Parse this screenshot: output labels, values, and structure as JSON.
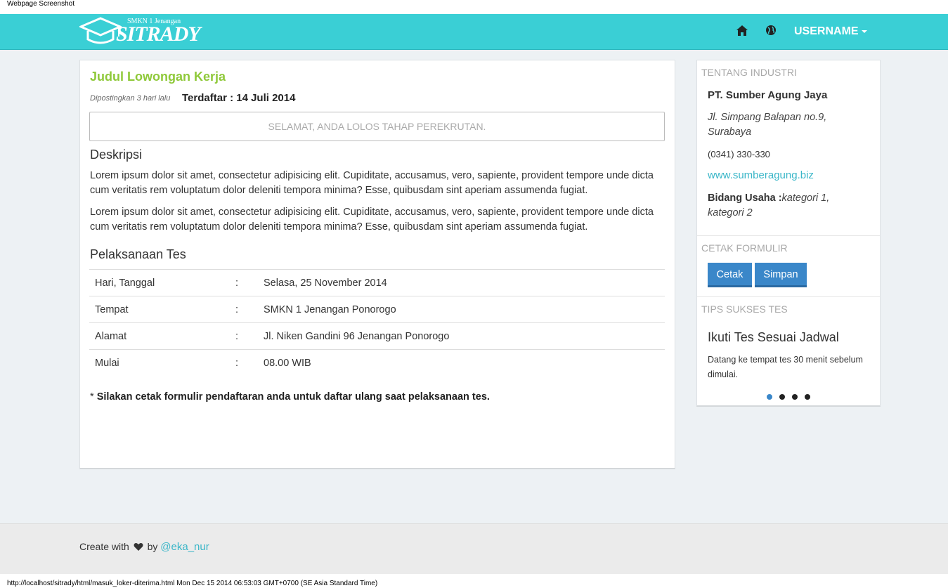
{
  "print_header": "Webpage Screenshot",
  "brand": {
    "sub": "SMKN 1 Jenangan",
    "name": "SITRADY"
  },
  "nav": {
    "user_label": "USERNAME"
  },
  "job": {
    "title": "Judul Lowongan Kerja",
    "posted": "Dipostingkan 3 hari lalu",
    "registered": "Terdaftar : 14 Juli 2014",
    "alert": "SELAMAT, ANDA LOLOS TAHAP PEREKRUTAN.",
    "desc_heading": "Deskripsi",
    "paragraphs": [
      "Lorem ipsum dolor sit amet, consectetur adipisicing elit. Cupiditate, accusamus, vero, sapiente, provident tempore unde dicta cum veritatis rem voluptatum dolor deleniti tempora minima? Esse, quibusdam sint aperiam assumenda fugiat.",
      "Lorem ipsum dolor sit amet, consectetur adipisicing elit. Cupiditate, accusamus, vero, sapiente, provident tempore unde dicta cum veritatis rem voluptatum dolor deleniti tempora minima? Esse, quibusdam sint aperiam assumenda fugiat."
    ],
    "test_heading": "Pelaksanaan Tes",
    "test_rows": [
      {
        "key": "Hari, Tanggal",
        "sep": ":",
        "value": "Selasa, 25 November 2014"
      },
      {
        "key": "Tempat",
        "sep": ":",
        "value": "SMKN 1 Jenangan Ponorogo"
      },
      {
        "key": "Alamat",
        "sep": ":",
        "value": "Jl. Niken Gandini 96 Jenangan Ponorogo"
      },
      {
        "key": "Mulai",
        "sep": ":",
        "value": "08.00 WIB"
      }
    ],
    "note_prefix": "*",
    "note": "Silakan cetak formulir pendaftaran anda untuk daftar ulang saat pelaksanaan tes."
  },
  "sidebar": {
    "industry_heading": "TENTANG INDUSTRI",
    "company": "PT. Sumber Agung Jaya",
    "address": "Jl. Simpang Balapan no.9, Surabaya",
    "phone": "(0341) 330-330",
    "website": "www.sumberagung.biz",
    "field_label": "Bidang Usaha :",
    "field_value": "kategori 1, kategori 2",
    "print_heading": "CETAK FORMULIR",
    "btn_print": "Cetak",
    "btn_save": "Simpan",
    "tips_heading": "TIPS SUKSES TES",
    "tip_title": "Ikuti Tes Sesuai Jadwal",
    "tip_text": "Datang ke tempat tes 30 menit sebelum dimulai.",
    "carousel_active": 1,
    "carousel_total": 4
  },
  "footer": {
    "prefix": "Create with",
    "by": "by",
    "link": "@eka_nur"
  },
  "print_footer": "http://localhost/sitrady/html/masuk_loker-diterima.html Mon Dec 15 2014 06:53:03 GMT+0700 (SE Asia Standard Time)",
  "colors": {
    "navbar": "#3acfd5",
    "accent_green": "#8fc93a",
    "link": "#3ab6c8",
    "button": "#3a87c9"
  }
}
